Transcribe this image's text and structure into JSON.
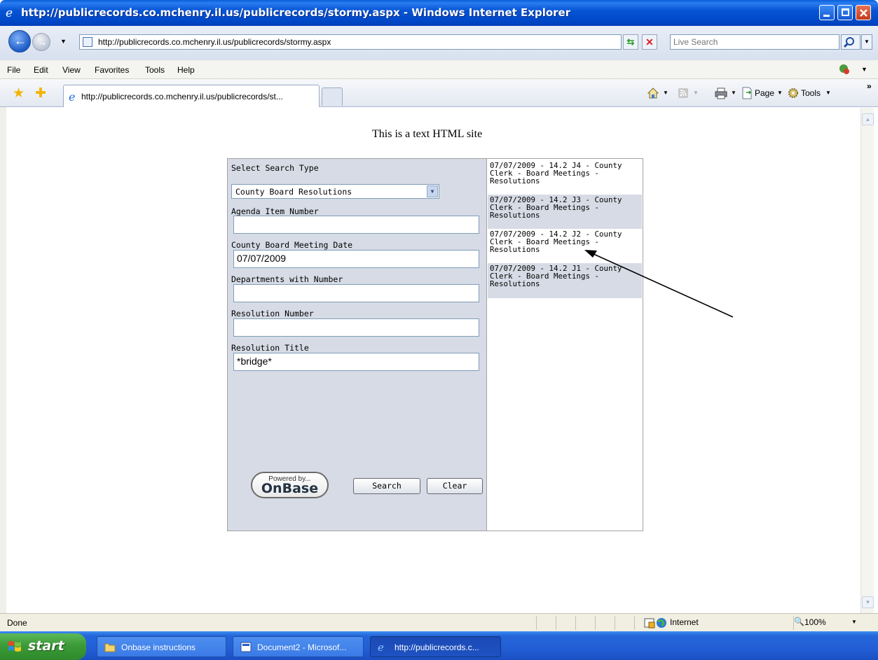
{
  "window": {
    "title": "http://publicrecords.co.mchenry.il.us/publicrecords/stormy.aspx - Windows Internet Explorer"
  },
  "address_bar": {
    "url": "http://publicrecords.co.mchenry.il.us/publicrecords/stormy.aspx",
    "search_placeholder": "Live Search"
  },
  "menu": [
    "File",
    "Edit",
    "View",
    "Favorites",
    "Tools",
    "Help"
  ],
  "tabs": {
    "active_label": "http://publicrecords.co.mchenry.il.us/publicrecords/st...",
    "page_label": "Page",
    "tools_label": "Tools",
    "more_glyph": "»"
  },
  "page": {
    "site_note": "This is a text HTML site",
    "search_type_label": "Select Search Type",
    "search_type_value": "County Board Resolutions",
    "fields": [
      {
        "label": "Agenda Item Number",
        "value": ""
      },
      {
        "label": "County Board Meeting Date",
        "value": "07/07/2009"
      },
      {
        "label": "Departments with Number",
        "value": ""
      },
      {
        "label": "Resolution Number",
        "value": ""
      },
      {
        "label": "Resolution Title",
        "value": "*bridge*"
      }
    ],
    "powered_by": "Powered by...",
    "brand": "OnBase",
    "search_button": "Search",
    "clear_button": "Clear",
    "results": [
      "07/07/2009 - 14.2 J4 - County Clerk - Board Meetings - Resolutions",
      "07/07/2009 - 14.2 J3 - County Clerk - Board Meetings - Resolutions",
      "07/07/2009 - 14.2 J2 - County Clerk - Board Meetings - Resolutions",
      "07/07/2009 - 14.2 J1 - County Clerk - Board Meetings - Resolutions"
    ]
  },
  "status": {
    "text": "Done",
    "zone": "Internet",
    "zoom": "100%"
  },
  "taskbar": {
    "start": "start",
    "items": [
      "Onbase instructions",
      "Document2 - Microsof...",
      "http://publicrecords.c..."
    ]
  },
  "colors": {
    "panel_bg": "#d6dbe5",
    "titlebar": "#0655d6",
    "start_green": "#3c9a38"
  }
}
